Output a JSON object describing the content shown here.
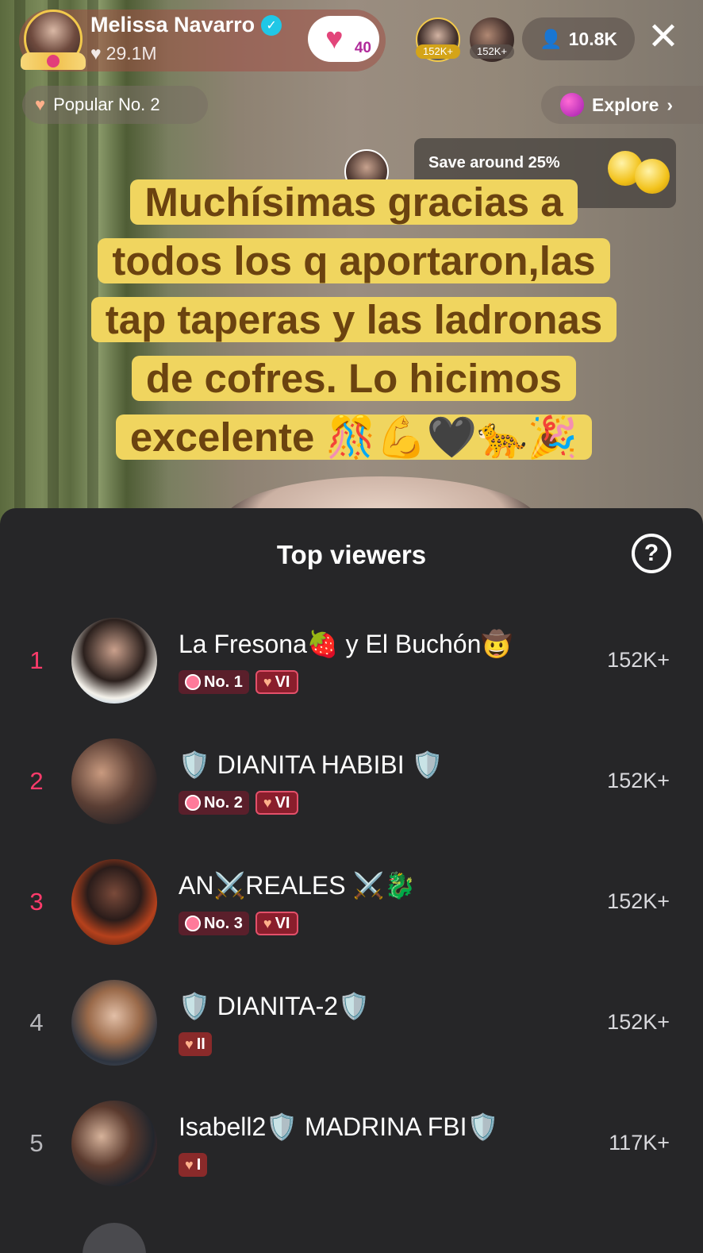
{
  "host": {
    "name": "Melissa Navarro",
    "likes": "29.1M",
    "follow_level": "40"
  },
  "top_viewers_preview": [
    {
      "badge": "152K+"
    },
    {
      "badge": "152K+"
    }
  ],
  "viewer_count": "10.8K",
  "popular": {
    "label": "Popular No. 2"
  },
  "explore": {
    "label": "Explore"
  },
  "promo": {
    "text": "Save around 25%"
  },
  "caption": {
    "lines": [
      "Muchísimas gracias a",
      "todos los q aportaron,las",
      "tap taperas y las ladronas",
      "de cofres. Lo hicimos",
      "excelente 🎊💪🖤🐆🎉"
    ]
  },
  "sheet": {
    "title": "Top viewers",
    "help": "?",
    "viewers": [
      {
        "rank": "1",
        "name": "La Fresona🍓 y El Buchón🤠",
        "rank_badge": "No. 1",
        "vip": "VI",
        "score": "152K+"
      },
      {
        "rank": "2",
        "name": "🛡️ DIANITA HABIBI 🛡️",
        "rank_badge": "No. 2",
        "vip": "VI",
        "score": "152K+"
      },
      {
        "rank": "3",
        "name": "AN⚔️REALES ⚔️🐉",
        "rank_badge": "No. 3",
        "vip": "VI",
        "score": "152K+"
      },
      {
        "rank": "4",
        "name": "🛡️ DIANITA-2🛡️",
        "level": "II",
        "score": "152K+"
      },
      {
        "rank": "5",
        "name": "Isabell2🛡️ MADRINA FBI🛡️",
        "level": "I",
        "score": "117K+"
      }
    ]
  },
  "colors": {
    "accent_rank": "#ff3b6b",
    "caption_bg": "#f0d55f",
    "caption_text": "#6b4310",
    "sheet_bg": "#262628"
  }
}
